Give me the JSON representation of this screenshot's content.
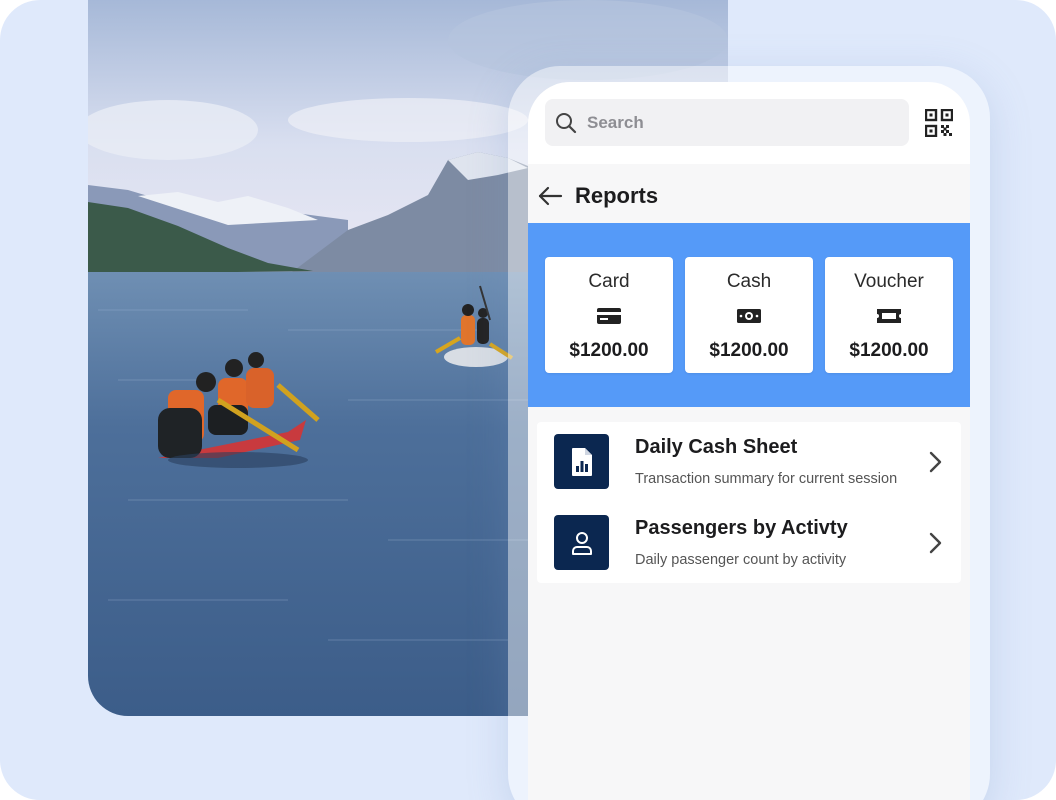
{
  "search": {
    "placeholder": "Search",
    "value": ""
  },
  "header": {
    "title": "Reports"
  },
  "payment_summary": [
    {
      "label": "Card",
      "amount": "$1200.00",
      "icon": "credit-card-icon"
    },
    {
      "label": "Cash",
      "amount": "$1200.00",
      "icon": "cash-icon"
    },
    {
      "label": "Voucher",
      "amount": "$1200.00",
      "icon": "voucher-icon"
    }
  ],
  "reports": [
    {
      "title": "Daily Cash Sheet",
      "subtitle": "Transaction summary for current session",
      "icon": "report-document-icon"
    },
    {
      "title": "Passengers by Activty",
      "subtitle": "Daily passenger count by activity",
      "icon": "person-icon"
    }
  ],
  "colors": {
    "background": "#dfe9fb",
    "accent_blue": "#559af8",
    "icon_badge": "#0b2750"
  }
}
